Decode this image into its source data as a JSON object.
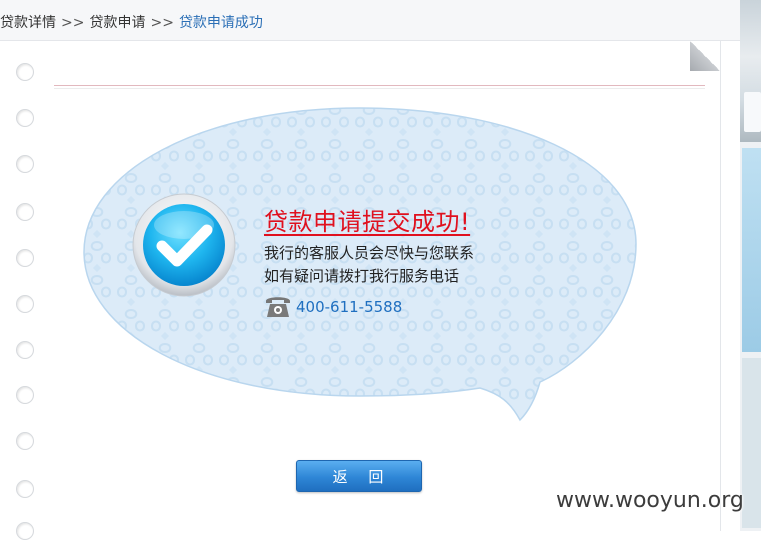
{
  "breadcrumb": {
    "items": [
      "贷款详情",
      "贷款申请",
      "贷款申请成功"
    ],
    "separator": ">>"
  },
  "result": {
    "title": "贷款申请提交成功!",
    "line1": "我行的客服人员会尽快与您联系",
    "line2": "如有疑问请拨打我行服务电话",
    "phone": "400-611-5588"
  },
  "actions": {
    "back_label": "返 回"
  },
  "watermark": "www.wooyun.org",
  "icons": {
    "success": "checkmark-circle-icon",
    "phone": "telephone-icon"
  },
  "colors": {
    "title_red": "#e0101e",
    "link_blue": "#1f6fc0",
    "button_blue": "#2e86d6",
    "bubble_fill": "#dcebf8"
  }
}
